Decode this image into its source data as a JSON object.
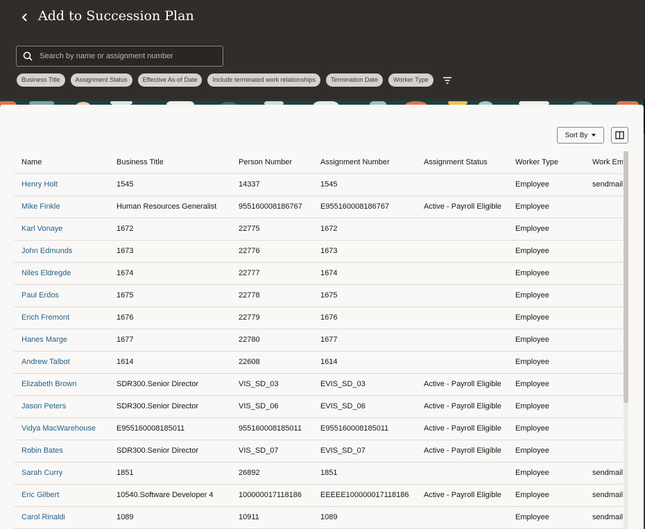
{
  "header": {
    "title": "Add to Succession Plan",
    "search_placeholder": "Search by name or assignment number"
  },
  "filters": [
    "Business Title",
    "Assignment Status",
    "Effective As-of Date",
    "Include terminated work relationships",
    "Termination Date",
    "Worker Type"
  ],
  "toolbar": {
    "sort_label": "Sort By"
  },
  "table": {
    "columns": [
      "Name",
      "Business Title",
      "Person Number",
      "Assignment Number",
      "Assignment Status",
      "Worker Type",
      "Work Em"
    ],
    "rows": [
      {
        "name": "Henry Holt",
        "title": "1545",
        "person": "14337",
        "assignment": "1545",
        "status": "",
        "type": "Employee",
        "email": "sendmail"
      },
      {
        "name": "Mike Finkle",
        "title": "Human Resources Generalist",
        "person": "955160008186767",
        "assignment": "E955160008186767",
        "status": "Active - Payroll Eligible",
        "type": "Employee",
        "email": ""
      },
      {
        "name": "Karl Vonaye",
        "title": "1672",
        "person": "22775",
        "assignment": "1672",
        "status": "",
        "type": "Employee",
        "email": ""
      },
      {
        "name": "John Edmunds",
        "title": "1673",
        "person": "22776",
        "assignment": "1673",
        "status": "",
        "type": "Employee",
        "email": ""
      },
      {
        "name": "Niles Eldregde",
        "title": "1674",
        "person": "22777",
        "assignment": "1674",
        "status": "",
        "type": "Employee",
        "email": ""
      },
      {
        "name": "Paul Erdos",
        "title": "1675",
        "person": "22778",
        "assignment": "1675",
        "status": "",
        "type": "Employee",
        "email": ""
      },
      {
        "name": "Erich Fremont",
        "title": "1676",
        "person": "22779",
        "assignment": "1676",
        "status": "",
        "type": "Employee",
        "email": ""
      },
      {
        "name": "Hanes Marge",
        "title": "1677",
        "person": "22780",
        "assignment": "1677",
        "status": "",
        "type": "Employee",
        "email": ""
      },
      {
        "name": "Andrew Talbot",
        "title": "1614",
        "person": "22608",
        "assignment": "1614",
        "status": "",
        "type": "Employee",
        "email": ""
      },
      {
        "name": "Elizabeth Brown",
        "title": "SDR300.Senior Director",
        "person": "VIS_SD_03",
        "assignment": "EVIS_SD_03",
        "status": "Active - Payroll Eligible",
        "type": "Employee",
        "email": ""
      },
      {
        "name": "Jason Peters",
        "title": "SDR300.Senior Director",
        "person": "VIS_SD_06",
        "assignment": "EVIS_SD_06",
        "status": "Active - Payroll Eligible",
        "type": "Employee",
        "email": ""
      },
      {
        "name": "Vidya MacWarehouse",
        "title": "E955160008185011",
        "person": "955160008185011",
        "assignment": "E955160008185011",
        "status": "Active - Payroll Eligible",
        "type": "Employee",
        "email": ""
      },
      {
        "name": "Robin Bates",
        "title": "SDR300.Senior Director",
        "person": "VIS_SD_07",
        "assignment": "EVIS_SD_07",
        "status": "Active - Payroll Eligible",
        "type": "Employee",
        "email": ""
      },
      {
        "name": "Sarah Curry",
        "title": "1851",
        "person": "26892",
        "assignment": "1851",
        "status": "",
        "type": "Employee",
        "email": "sendmail"
      },
      {
        "name": "Eric Gilbert",
        "title": "10540.Software Developer 4",
        "person": "100000017118186",
        "assignment": "EEEEE100000017118186",
        "status": "Active - Payroll Eligible",
        "type": "Employee",
        "email": "sendmail"
      },
      {
        "name": "Carol Rinaldi",
        "title": "1089",
        "person": "10911",
        "assignment": "1089",
        "status": "",
        "type": "Employee",
        "email": "sendmail"
      }
    ]
  }
}
